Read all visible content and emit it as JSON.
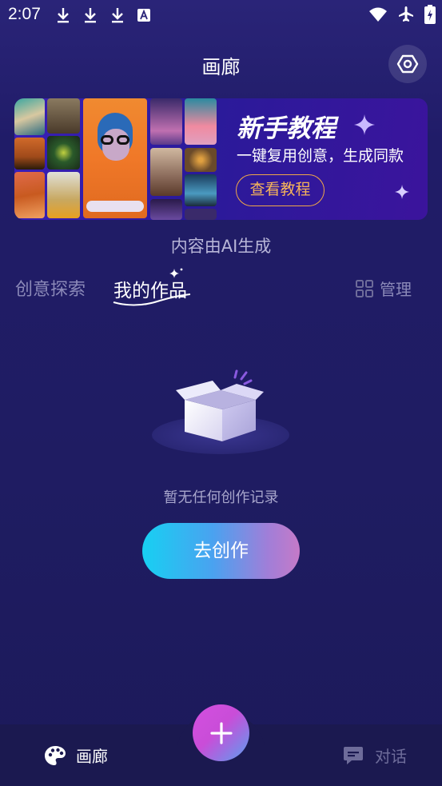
{
  "status": {
    "time": "2:07",
    "icons": [
      "download-icon",
      "download-icon",
      "download-icon",
      "text-a-icon",
      "wifi-icon",
      "airplane-icon",
      "battery-charging-icon"
    ]
  },
  "header": {
    "title": "画廊",
    "settings_icon": "hexagon-settings-icon"
  },
  "banner": {
    "title": "新手教程",
    "subtitle": "一键复用创意，生成同款",
    "button_label": "查看教程"
  },
  "ai_note": "内容由AI生成",
  "tabs": {
    "items": [
      {
        "label": "创意探索",
        "active": false
      },
      {
        "label": "我的作品",
        "active": true
      }
    ],
    "manage_label": "管理",
    "manage_icon": "grid-icon"
  },
  "empty_state": {
    "message": "暂无任何创作记录",
    "illustration": "open-box-icon"
  },
  "create_button": {
    "label": "去创作"
  },
  "bottom_nav": {
    "items": [
      {
        "label": "画廊",
        "icon": "palette-icon",
        "active": true
      },
      {
        "label": "对话",
        "icon": "chat-bubble-icon",
        "active": false
      }
    ],
    "fab_icon": "plus-icon"
  },
  "colors": {
    "background": "#201c68",
    "accent_orange": "#f6b45a",
    "button_gradient_start": "#17d0f2",
    "button_gradient_end": "#c57ac8",
    "inactive_text": "#8b89b8"
  }
}
